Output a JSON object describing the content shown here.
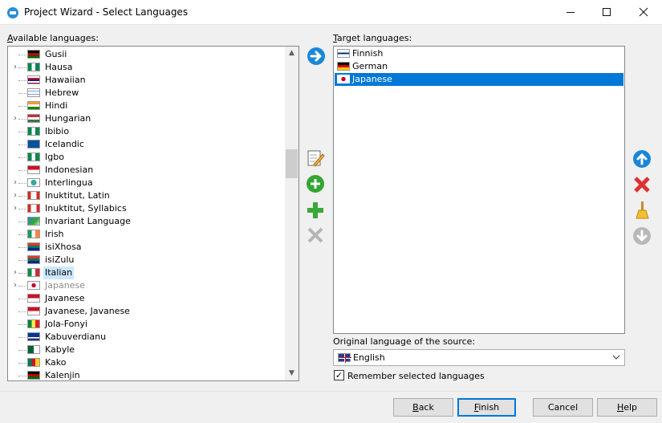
{
  "window": {
    "title": "Project Wizard - Select Languages",
    "minimize": "—",
    "maximize": "☐",
    "close": "✕"
  },
  "available": {
    "label_prefix": "",
    "label_underlined": "A",
    "label_rest": "vailable languages:",
    "items": [
      {
        "name": "Gusii",
        "expandable": false
      },
      {
        "name": "Hausa",
        "expandable": true
      },
      {
        "name": "Hawaiian",
        "expandable": false
      },
      {
        "name": "Hebrew",
        "expandable": false
      },
      {
        "name": "Hindi",
        "expandable": false
      },
      {
        "name": "Hungarian",
        "expandable": true
      },
      {
        "name": "Ibibio",
        "expandable": false
      },
      {
        "name": "Icelandic",
        "expandable": false
      },
      {
        "name": "Igbo",
        "expandable": false
      },
      {
        "name": "Indonesian",
        "expandable": false
      },
      {
        "name": "Interlingua",
        "expandable": true
      },
      {
        "name": "Inuktitut, Latin",
        "expandable": true
      },
      {
        "name": "Inuktitut, Syllabics",
        "expandable": true
      },
      {
        "name": "Invariant Language",
        "expandable": false
      },
      {
        "name": "Irish",
        "expandable": false
      },
      {
        "name": "isiXhosa",
        "expandable": false
      },
      {
        "name": "isiZulu",
        "expandable": false
      },
      {
        "name": "Italian",
        "expandable": true,
        "selected": true
      },
      {
        "name": "Japanese",
        "expandable": true,
        "grayed": true
      },
      {
        "name": "Javanese",
        "expandable": false
      },
      {
        "name": "Javanese, Javanese",
        "expandable": false
      },
      {
        "name": "Jola-Fonyi",
        "expandable": false
      },
      {
        "name": "Kabuverdianu",
        "expandable": false
      },
      {
        "name": "Kabyle",
        "expandable": false
      },
      {
        "name": "Kako",
        "expandable": false
      },
      {
        "name": "Kalenjin",
        "expandable": false
      }
    ]
  },
  "target": {
    "label_underlined": "T",
    "label_rest": "arget languages:",
    "items": [
      {
        "name": "Finnish",
        "selected": false
      },
      {
        "name": "German",
        "selected": false
      },
      {
        "name": "Japanese",
        "selected": true
      }
    ]
  },
  "source": {
    "label": "Original language of the source:",
    "value": "English"
  },
  "remember": {
    "label": "Remember selected languages",
    "checked": "✓"
  },
  "buttons": {
    "back_underlined": "B",
    "back_rest": "ack",
    "finish_underlined": "F",
    "finish_rest": "inish",
    "cancel": "Cancel",
    "help_underlined": "H",
    "help_rest": "elp"
  },
  "icons": {
    "accent": "#0078d7",
    "add_arrow": "arrow-right-icon",
    "edit": "pencil-icon",
    "add_custom": "plus-circle-icon",
    "add": "plus-icon",
    "remove": "x-gray-icon",
    "move_up": "arrow-up-icon",
    "delete": "red-x-icon",
    "clear": "broom-icon",
    "move_down": "arrow-down-icon"
  }
}
